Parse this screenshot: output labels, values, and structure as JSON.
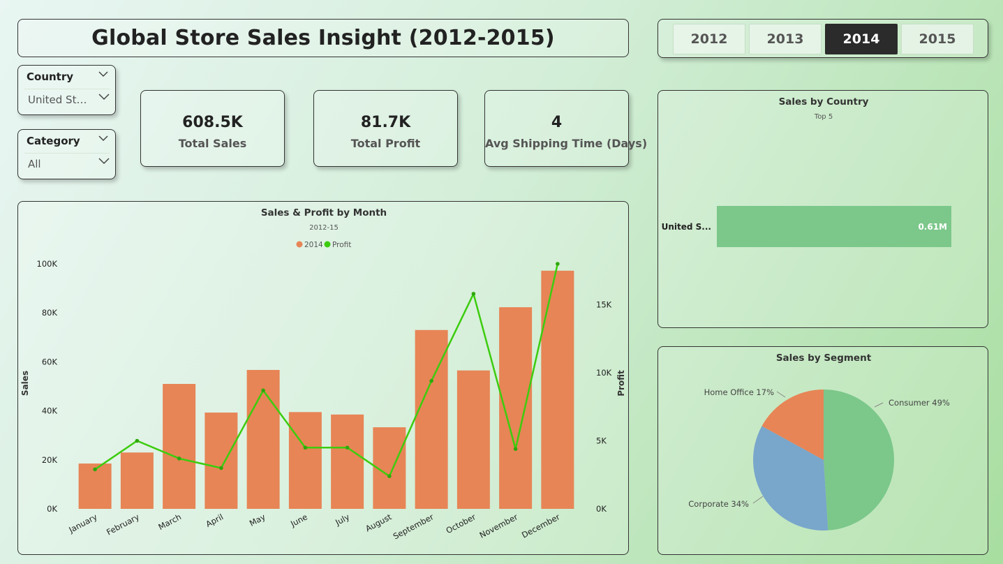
{
  "header": {
    "title": "Global Store Sales Insight (2012-2015)"
  },
  "year_slicer": {
    "options": [
      "2012",
      "2013",
      "2014",
      "2015"
    ],
    "selected": "2014"
  },
  "filters": {
    "country": {
      "label": "Country",
      "value": "United Stat..."
    },
    "category": {
      "label": "Category",
      "value": "All"
    }
  },
  "kpis": {
    "total_sales": {
      "value": "608.5K",
      "label": "Total Sales"
    },
    "total_profit": {
      "value": "81.7K",
      "label": "Total Profit"
    },
    "avg_shipping": {
      "value": "4",
      "label": "Avg Shipping Time (Days)"
    }
  },
  "colors": {
    "bar": "#e78556",
    "profit_line": "#3ccc0e",
    "consumer": "#7cc78a",
    "corporate": "#79a6cb",
    "home_office": "#e78556",
    "country_bar": "#7cc78a"
  },
  "chart_data": [
    {
      "type": "bar+line",
      "title": "Sales & Profit by Month",
      "subtitle": "2012-15",
      "categories": [
        "January",
        "February",
        "March",
        "April",
        "May",
        "June",
        "July",
        "August",
        "September",
        "October",
        "November",
        "December"
      ],
      "series": [
        {
          "name": "2014",
          "axis": "left",
          "type": "bar",
          "values": [
            18500,
            23000,
            51000,
            39300,
            56700,
            39500,
            38500,
            33300,
            73000,
            56500,
            82300,
            97200
          ]
        },
        {
          "name": "Profit",
          "axis": "right",
          "type": "line",
          "values": [
            2900,
            5000,
            3700,
            3000,
            8700,
            4500,
            4500,
            2400,
            9400,
            15800,
            4400,
            18000
          ]
        }
      ],
      "ylabel": "Sales",
      "y2label": "Profit",
      "ylim": [
        0,
        100000
      ],
      "yticks": [
        "0K",
        "20K",
        "40K",
        "60K",
        "80K",
        "100K"
      ],
      "y2lim": [
        0,
        18000
      ],
      "y2ticks": [
        "0K",
        "5K",
        "10K",
        "15K"
      ],
      "legend": "top-center"
    },
    {
      "type": "bar",
      "orientation": "horizontal",
      "title": "Sales by Country",
      "subtitle": "Top 5",
      "categories": [
        "United S..."
      ],
      "values": [
        0.61
      ],
      "value_labels": [
        "0.61M"
      ]
    },
    {
      "type": "pie",
      "title": "Sales by Segment",
      "labels": [
        "Consumer",
        "Corporate",
        "Home Office"
      ],
      "values": [
        49,
        34,
        17
      ],
      "data_labels": [
        "Consumer 49%",
        "Corporate 34%",
        "Home Office 17%"
      ]
    }
  ]
}
